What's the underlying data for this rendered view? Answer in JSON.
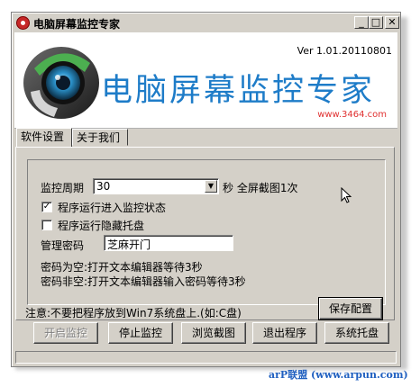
{
  "window": {
    "title": "电脑屏幕监控专家",
    "controls": {
      "minimize": "_",
      "maximize": "□",
      "close": "✕"
    }
  },
  "banner": {
    "version": "Ver  1.01.20110801",
    "app_name": "电脑屏幕监控专家",
    "website": "www.3464.com",
    "logo_icon": "camera-lens-icon"
  },
  "tabs": [
    {
      "label": "软件设置",
      "active": true
    },
    {
      "label": "关于我们",
      "active": false
    }
  ],
  "settings": {
    "period_label": "监控周期",
    "period_value": "30",
    "period_suffix": "秒 全屏截图1次",
    "auto_monitor": {
      "label": "程序运行进入监控状态",
      "checked": true
    },
    "hide_tray": {
      "label": "程序运行隐藏托盘",
      "checked": false
    },
    "password_label": "管理密码",
    "password_value": "芝麻开门",
    "hint_empty": "密码为空:打开文本编辑器等待3秒",
    "hint_nonempty": "密码非空:打开文本编辑器输入密码等待3秒",
    "notice": "注意:不要把程序放到Win7系统盘上.(如:C盘)",
    "save_button": "保存配置"
  },
  "actions": {
    "start": "开启监控",
    "stop": "停止监控",
    "browse": "浏览截图",
    "exit": "退出程序",
    "tray": "系统托盘"
  },
  "watermark": "arP联盟 (www.arpun.com)",
  "colors": {
    "title_blue": "#1e7cc8",
    "url_red": "#e03030",
    "face": "#d4d0c8"
  }
}
